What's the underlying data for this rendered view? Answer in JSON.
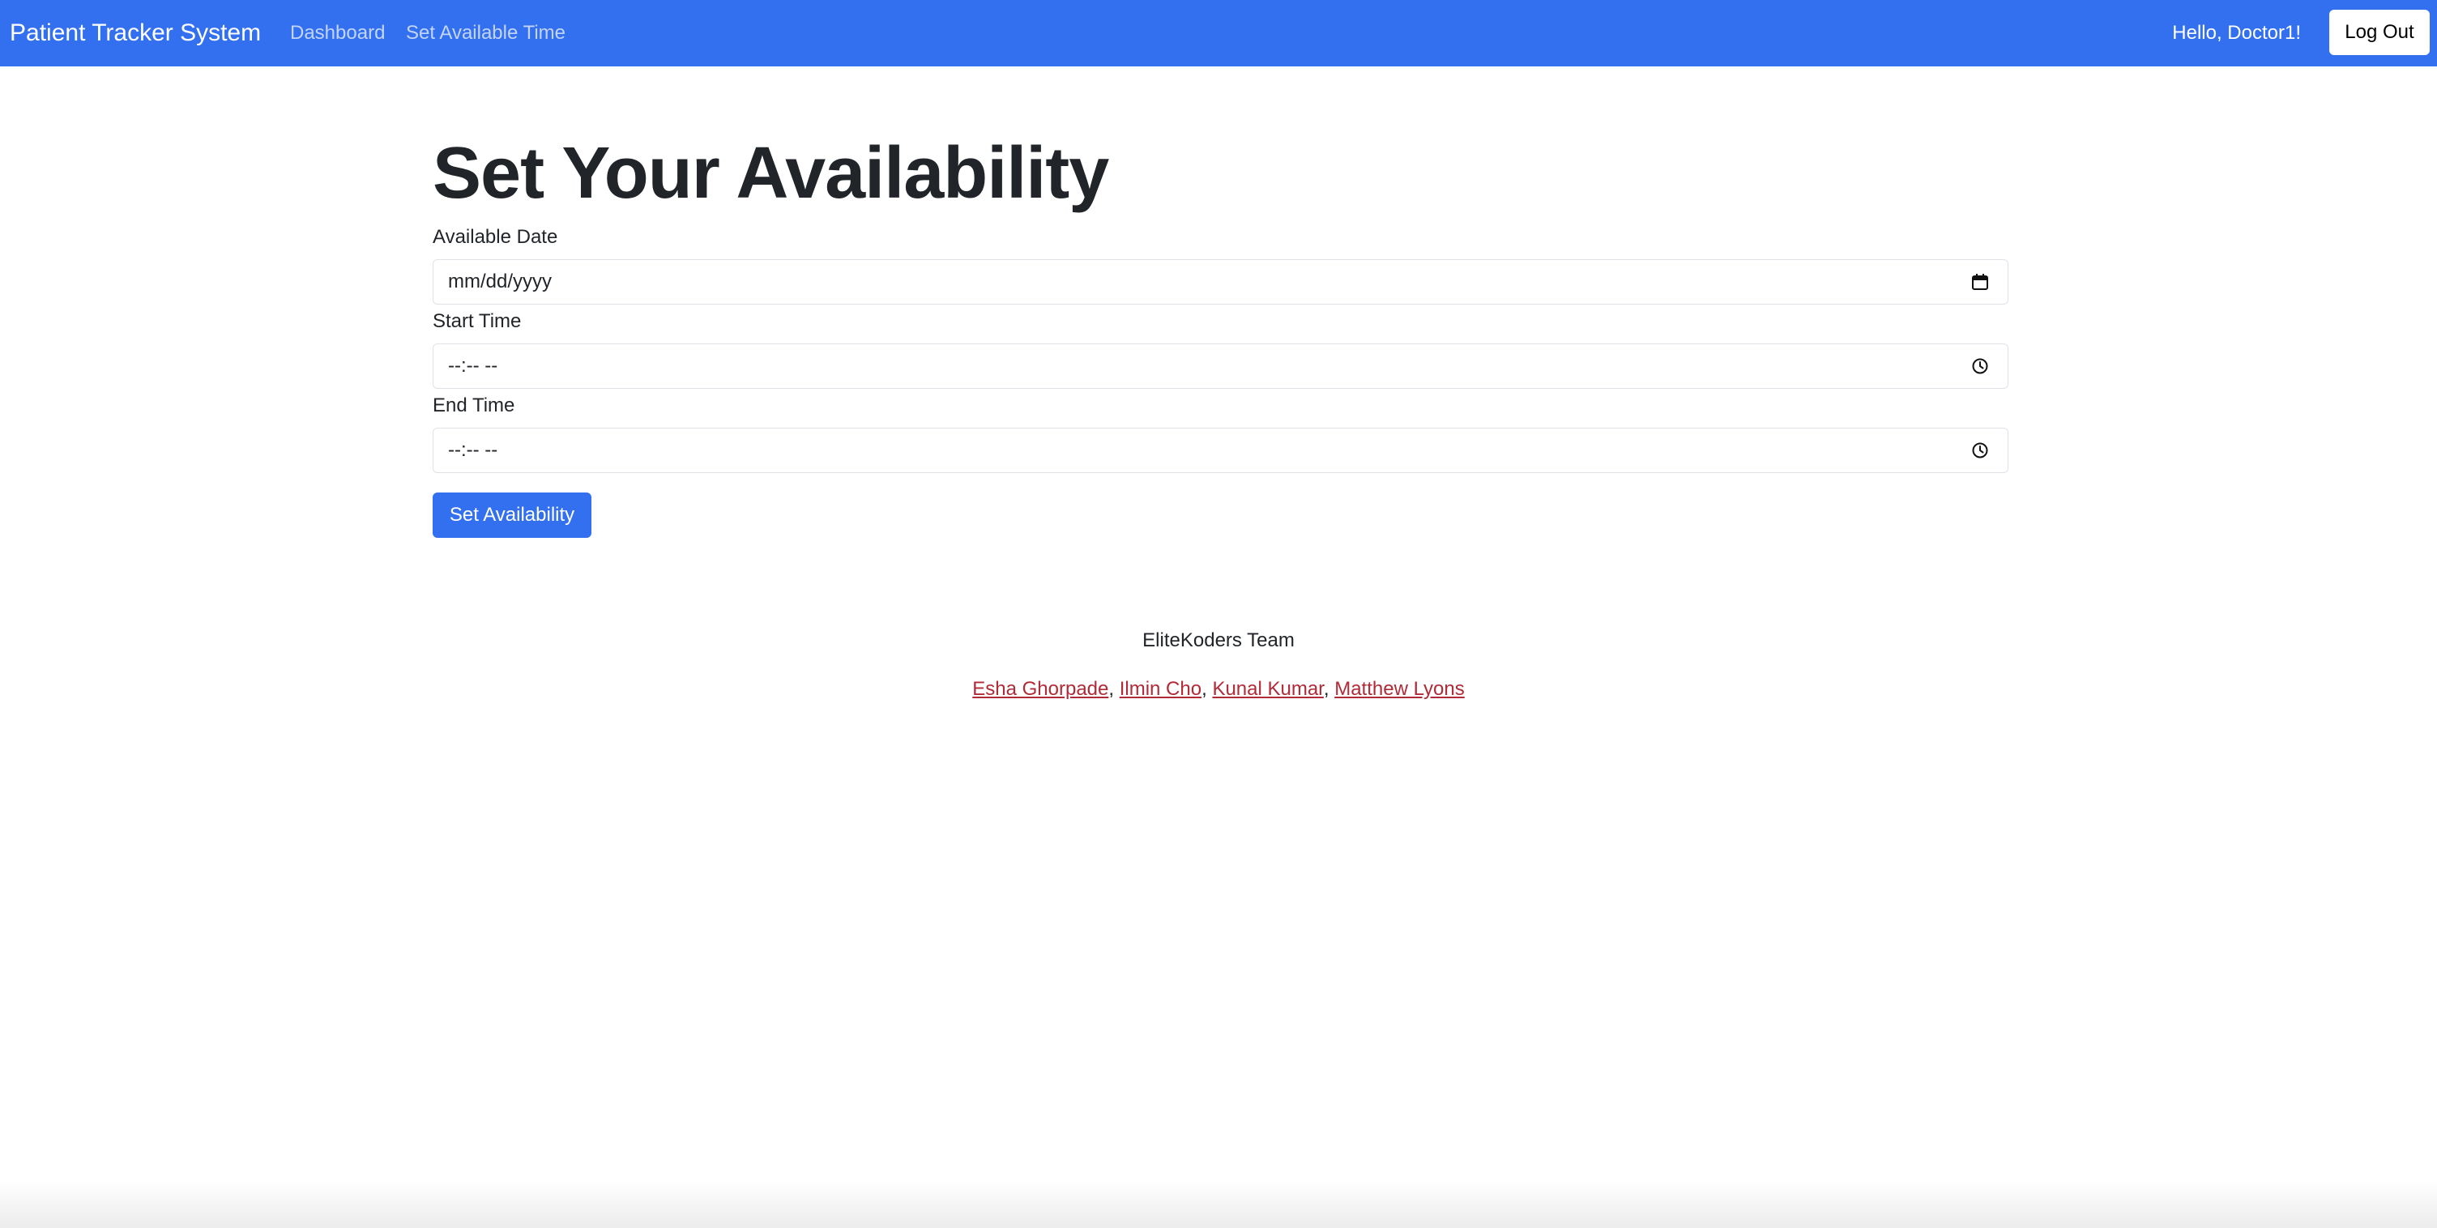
{
  "navbar": {
    "brand": "Patient Tracker System",
    "links": [
      {
        "label": "Dashboard"
      },
      {
        "label": "Set Available Time"
      }
    ],
    "greeting": "Hello, Doctor1!",
    "logout_label": "Log Out",
    "background_color": "#3370f0"
  },
  "page": {
    "title": "Set Your Availability"
  },
  "form": {
    "available_date": {
      "label": "Available Date",
      "value": "mm/dd/yyyy",
      "icon": "calendar-icon"
    },
    "start_time": {
      "label": "Start Time",
      "value": "--:-- --",
      "icon": "clock-icon"
    },
    "end_time": {
      "label": "End Time",
      "value": "--:-- --",
      "icon": "clock-icon"
    },
    "submit_label": "Set Availability"
  },
  "footer": {
    "team": "EliteKoders Team",
    "members": [
      {
        "name": "Esha Ghorpade"
      },
      {
        "name": "Ilmin Cho"
      },
      {
        "name": "Kunal Kumar"
      },
      {
        "name": "Matthew Lyons"
      }
    ],
    "separator": ", ",
    "link_color": "#b02a37"
  }
}
